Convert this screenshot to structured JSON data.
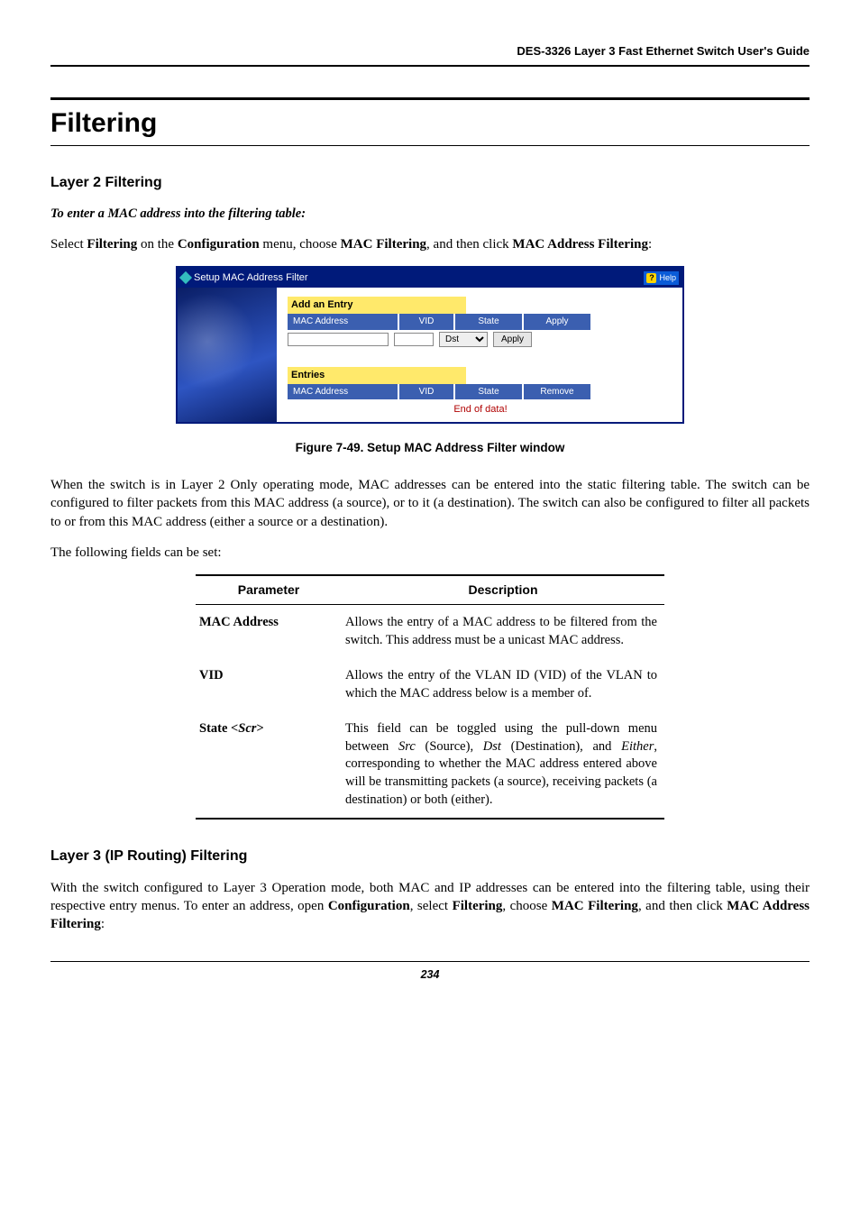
{
  "header": {
    "doc_title": "DES-3326 Layer 3 Fast Ethernet Switch User's Guide"
  },
  "page": {
    "h1": "Filtering",
    "l2_heading": "Layer 2 Filtering",
    "l2_intro_ital": "To enter a MAC address into the filtering table:",
    "l2_select_pre": "Select ",
    "l2_filtering": "Filtering",
    "l2_on_the": " on the ",
    "l2_config": "Configuration",
    "l2_menu_choose": " menu, choose ",
    "l2_macfilt": "MAC Filtering",
    "l2_and_then": ", and then click ",
    "l2_macaddrfilt": "MAC Address Filtering",
    "l2_colon": ":",
    "fig_caption": "Figure 7-49.  Setup MAC Address Filter window",
    "l2_explain": "When the switch is in Layer 2 Only operating mode, MAC addresses can be entered into the static filtering table. The switch can be configured to filter packets from this MAC address (a source), or to it (a destination). The switch can also be configured to filter all packets to or from this MAC address (either a source or a destination).",
    "fields_intro": "The following fields can be set:",
    "l3_heading": "Layer 3 (IP Routing) Filtering",
    "l3_p_pre": "With the switch configured to Layer 3 Operation mode, both MAC and IP addresses can be entered into the filtering table, using their respective entry menus. To enter an address, open ",
    "l3_config": "Configuration",
    "l3_select": ", select ",
    "l3_filtering": "Filtering",
    "l3_choose": ", choose ",
    "l3_macfilt": "MAC Filtering",
    "l3_then": ", and then click ",
    "l3_macaddrfilt": "MAC Address Filtering",
    "l3_colon": ":",
    "footer_pageno": "234"
  },
  "ui": {
    "titlebar": "Setup MAC Address Filter",
    "help": "Help",
    "add_entry": "Add an Entry",
    "entries": "Entries",
    "col_mac": "MAC Address",
    "col_vid": "VID",
    "col_state": "State",
    "col_apply": "Apply",
    "col_remove": "Remove",
    "state_value": "Dst",
    "apply_btn": "Apply",
    "end": "End of data!"
  },
  "table": {
    "head_param": "Parameter",
    "head_desc": "Description",
    "rows": [
      {
        "name": "MAC Address",
        "desc": "Allows the entry of a MAC address to be filtered from the switch. This address must be a unicast MAC address."
      },
      {
        "name": "VID",
        "desc": "Allows the entry of the VLAN ID (VID) of the VLAN to which the MAC address below is a member of."
      }
    ],
    "state_name_pre": "State <",
    "state_name_ital": "Scr",
    "state_name_post": ">",
    "state_desc_1": "This field can be toggled using the pull-down menu between ",
    "state_src": "Src",
    "state_desc_2": " (Source), ",
    "state_dst": "Dst",
    "state_desc_3": " (Destination), and ",
    "state_either": "Either",
    "state_desc_4": ", corresponding to whether the MAC address entered above will be transmitting packets (a source), receiving packets (a destination) or both (either)."
  }
}
